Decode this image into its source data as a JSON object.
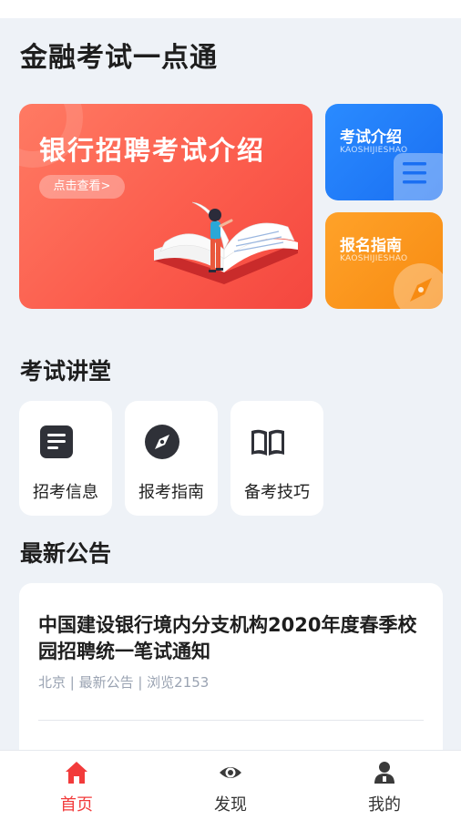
{
  "app": {
    "title": "金融考试一点通"
  },
  "banner": {
    "title": "银行招聘考试介绍",
    "button_label": "点击查看>"
  },
  "side_cards": [
    {
      "title": "考试介绍",
      "subtitle": "KAOSHIJIESHAO",
      "color": "#1f7cf7",
      "icon": "list-icon"
    },
    {
      "title": "报名指南",
      "subtitle": "KAOSHIJIESHAO",
      "color": "#f99618",
      "icon": "compass-icon"
    }
  ],
  "lecture": {
    "title": "考试讲堂",
    "items": [
      {
        "label": "招考信息",
        "icon": "document-icon"
      },
      {
        "label": "报考指南",
        "icon": "compass-icon"
      },
      {
        "label": "备考技巧",
        "icon": "book-icon"
      }
    ]
  },
  "announcements": {
    "title": "最新公告",
    "items": [
      {
        "title": "中国建设银行境内分支机构2020年度春季校园招聘统一笔试通知",
        "meta": "北京 | 最新公告 | 浏览2153"
      }
    ]
  },
  "bottom_nav": {
    "items": [
      {
        "label": "首页",
        "icon": "home-icon",
        "active": true
      },
      {
        "label": "发现",
        "icon": "eye-icon",
        "active": false
      },
      {
        "label": "我的",
        "icon": "user-icon",
        "active": false
      }
    ],
    "active_color": "#f23b3b"
  }
}
